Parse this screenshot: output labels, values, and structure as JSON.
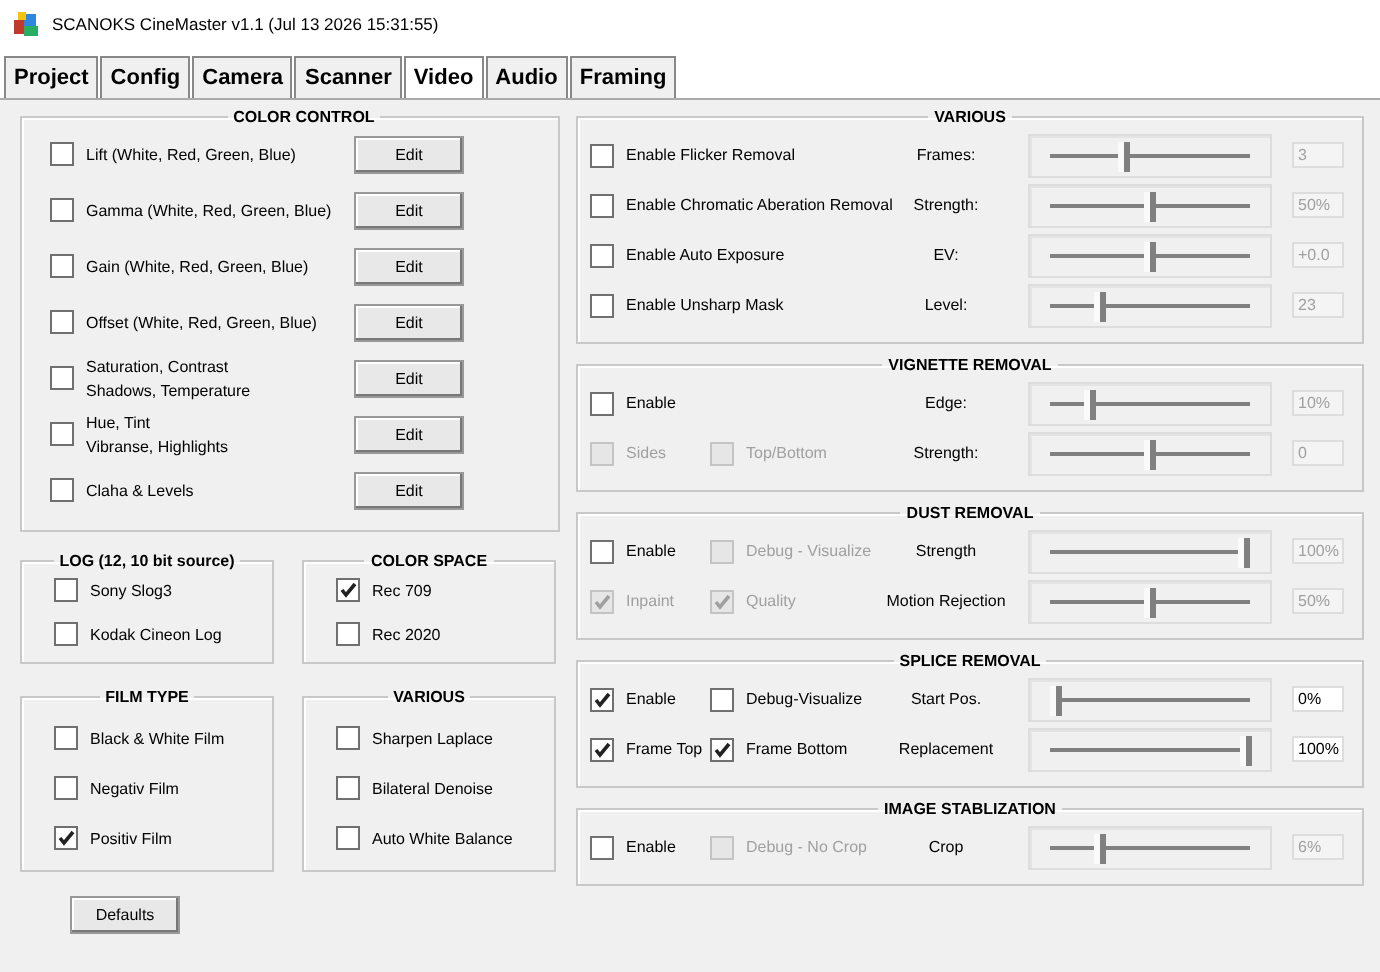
{
  "window": {
    "title": "SCANOKS CineMaster v1.1 (Jul 13 2026 15:31:55)"
  },
  "tabs": [
    {
      "label": "Project",
      "selected": false
    },
    {
      "label": "Config",
      "selected": false
    },
    {
      "label": "Camera",
      "selected": false
    },
    {
      "label": "Scanner",
      "selected": false
    },
    {
      "label": "Video",
      "selected": true
    },
    {
      "label": "Audio",
      "selected": false
    },
    {
      "label": "Framing",
      "selected": false
    }
  ],
  "color_control": {
    "title": "COLOR CONTROL",
    "rows": [
      {
        "lines": [
          "Lift (White, Red, Green, Blue)"
        ],
        "checked": false,
        "button": "Edit"
      },
      {
        "lines": [
          "Gamma (White, Red, Green, Blue)"
        ],
        "checked": false,
        "button": "Edit"
      },
      {
        "lines": [
          "Gain (White, Red, Green, Blue)"
        ],
        "checked": false,
        "button": "Edit"
      },
      {
        "lines": [
          "Offset (White, Red, Green, Blue)"
        ],
        "checked": false,
        "button": "Edit"
      },
      {
        "lines": [
          "Saturation, Contrast",
          "Shadows, Temperature"
        ],
        "checked": false,
        "button": "Edit"
      },
      {
        "lines": [
          "Hue, Tint",
          "Vibranse, Highlights"
        ],
        "checked": false,
        "button": "Edit"
      },
      {
        "lines": [
          "Claha & Levels"
        ],
        "checked": false,
        "button": "Edit"
      }
    ]
  },
  "left_groups": [
    {
      "title": "LOG (12, 10 bit source)",
      "options": [
        {
          "label": "Sony Slog3",
          "checked": false
        },
        {
          "label": "Kodak Cineon Log",
          "checked": false
        }
      ]
    },
    {
      "title": "COLOR SPACE",
      "options": [
        {
          "label": "Rec 709",
          "checked": true
        },
        {
          "label": "Rec 2020",
          "checked": false
        }
      ]
    },
    {
      "title": "FILM TYPE",
      "options": [
        {
          "label": "Black & White Film",
          "checked": false
        },
        {
          "label": "Negativ Film",
          "checked": false
        },
        {
          "label": "Positiv Film",
          "checked": true
        }
      ]
    },
    {
      "title": "VARIOUS",
      "options": [
        {
          "label": "Sharpen Laplace",
          "checked": false
        },
        {
          "label": "Bilateral Denoise",
          "checked": false
        },
        {
          "label": "Auto White Balance",
          "checked": false
        }
      ]
    }
  ],
  "defaults_button": "Defaults",
  "right_groups": [
    {
      "title": "VARIOUS",
      "rows": [
        {
          "checks": [
            {
              "label": "Enable Flicker Removal",
              "checked": false,
              "disabled": false
            }
          ],
          "slider": {
            "label": "Frames:",
            "level": 0.37,
            "value": "3",
            "disabled": true
          }
        },
        {
          "checks": [
            {
              "label": "Enable Chromatic Aberation Removal",
              "checked": false,
              "disabled": false
            }
          ],
          "slider": {
            "label": "Strength:",
            "level": 0.5,
            "value": "50%",
            "disabled": true
          }
        },
        {
          "checks": [
            {
              "label": "Enable Auto Exposure",
              "checked": false,
              "disabled": false
            }
          ],
          "slider": {
            "label": "EV:",
            "level": 0.5,
            "value": "+0.0",
            "disabled": true
          }
        },
        {
          "checks": [
            {
              "label": "Enable Unsharp Mask",
              "checked": false,
              "disabled": false
            }
          ],
          "slider": {
            "label": "Level:",
            "level": 0.25,
            "value": "23",
            "disabled": true
          }
        }
      ]
    },
    {
      "title": "VIGNETTE REMOVAL",
      "rows": [
        {
          "checks": [
            {
              "label": "Enable",
              "checked": false,
              "disabled": false
            }
          ],
          "slider": {
            "label": "Edge:",
            "level": 0.2,
            "value": "10%",
            "disabled": true
          }
        },
        {
          "checks": [
            {
              "label": "Sides",
              "checked": false,
              "disabled": true
            },
            {
              "label": "Top/Bottom",
              "checked": false,
              "disabled": true
            }
          ],
          "slider": {
            "label": "Strength:",
            "level": 0.5,
            "value": "0",
            "disabled": true
          }
        }
      ]
    },
    {
      "title": "DUST REMOVAL",
      "rows": [
        {
          "checks": [
            {
              "label": "Enable",
              "checked": false,
              "disabled": false
            },
            {
              "label": "Debug - Visualize",
              "checked": false,
              "disabled": true
            }
          ],
          "slider": {
            "label": "Strength",
            "level": 0.97,
            "value": "100%",
            "disabled": true
          }
        },
        {
          "checks": [
            {
              "label": "Inpaint",
              "checked": true,
              "disabled": true
            },
            {
              "label": "Quality",
              "checked": true,
              "disabled": true
            }
          ],
          "slider": {
            "label": "Motion Rejection",
            "level": 0.5,
            "value": "50%",
            "disabled": true
          }
        }
      ]
    },
    {
      "title": "SPLICE REMOVAL",
      "rows": [
        {
          "checks": [
            {
              "label": "Enable",
              "checked": true,
              "disabled": false
            },
            {
              "label": "Debug-Visualize",
              "checked": false,
              "disabled": false
            }
          ],
          "slider": {
            "label": "Start Pos.",
            "level": 0.03,
            "value": "0%",
            "disabled": false
          }
        },
        {
          "checks": [
            {
              "label": "Frame Top",
              "checked": true,
              "disabled": false
            },
            {
              "label": "Frame Bottom",
              "checked": true,
              "disabled": false
            }
          ],
          "slider": {
            "label": "Replacement",
            "level": 0.98,
            "value": "100%",
            "disabled": false
          }
        }
      ]
    },
    {
      "title": "IMAGE STABLIZATION",
      "rows": [
        {
          "checks": [
            {
              "label": "Enable",
              "checked": false,
              "disabled": false
            },
            {
              "label": "Debug - No Crop",
              "checked": false,
              "disabled": true
            }
          ],
          "slider": {
            "label": "Crop",
            "level": 0.25,
            "value": "6%",
            "disabled": true
          }
        }
      ]
    }
  ]
}
